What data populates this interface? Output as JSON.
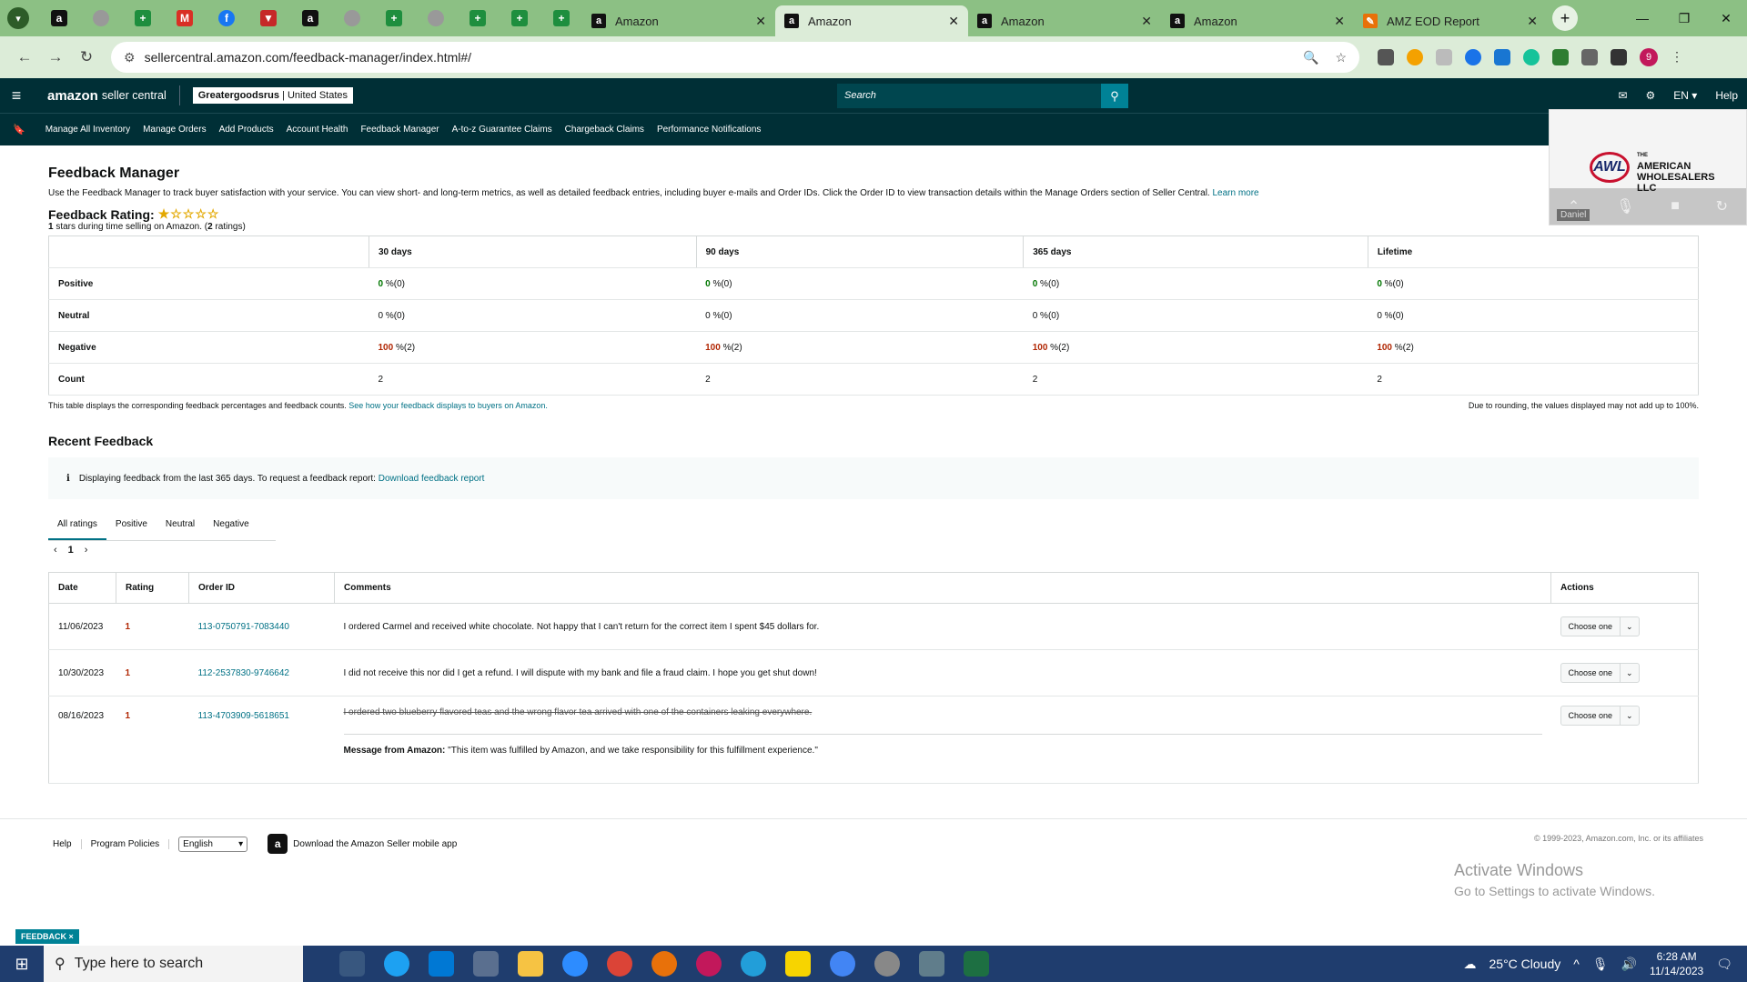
{
  "browser": {
    "tabs": [
      {
        "title": "Amazon"
      },
      {
        "title": "Amazon"
      },
      {
        "title": "Amazon"
      },
      {
        "title": "Amazon"
      },
      {
        "title": "AMZ EOD Report"
      }
    ],
    "url": "sellercentral.amazon.com/feedback-manager/index.html#/",
    "profile_initial": "9"
  },
  "header": {
    "logo": "amazon",
    "logo_suffix": "seller central",
    "store_name": "Greatergoodsrus",
    "store_region": "United States",
    "search_placeholder": "Search",
    "lang": "EN",
    "help": "Help"
  },
  "subnav": {
    "items": [
      "Manage All Inventory",
      "Manage Orders",
      "Add Products",
      "Account Health",
      "Feedback Manager",
      "A-to-z Guarantee Claims",
      "Chargeback Claims",
      "Performance Notifications"
    ]
  },
  "page": {
    "title": "Feedback Manager",
    "description": "Use the Feedback Manager to track buyer satisfaction with your service. You can view short- and long-term metrics, as well as detailed feedback entries, including buyer e-mails and Order IDs. Click the Order ID to view transaction details within the Manage Orders section of Seller Central.",
    "learn_more": "Learn more",
    "rating_label": "Feedback Rating:",
    "rating_stars": 1,
    "rating_sub_value": "1",
    "rating_sub_text": "stars during time selling on Amazon. (",
    "rating_count": "2",
    "rating_count_suffix": "ratings)"
  },
  "metrics": {
    "columns": [
      "30 days",
      "90 days",
      "365 days",
      "Lifetime"
    ],
    "rows": [
      {
        "label": "Positive",
        "cells": [
          [
            "0",
            " %(0)"
          ],
          [
            "0",
            " %(0)"
          ],
          [
            "0",
            " %(0)"
          ],
          [
            "0",
            " %(0)"
          ]
        ]
      },
      {
        "label": "Neutral",
        "cells": [
          [
            "",
            "0 %(0)"
          ],
          [
            "",
            "0 %(0)"
          ],
          [
            "",
            "0 %(0)"
          ],
          [
            "",
            "0 %(0)"
          ]
        ]
      },
      {
        "label": "Negative",
        "cells": [
          [
            "100",
            " %(2)"
          ],
          [
            "100",
            " %(2)"
          ],
          [
            "100",
            " %(2)"
          ],
          [
            "100",
            " %(2)"
          ]
        ]
      },
      {
        "label": "Count",
        "cells": [
          [
            "",
            "2"
          ],
          [
            "",
            "2"
          ],
          [
            "",
            "2"
          ],
          [
            "",
            "2"
          ]
        ]
      }
    ],
    "note_left": "This table displays the corresponding feedback percentages and feedback counts.",
    "note_link": "See how your feedback displays to buyers on Amazon.",
    "note_right": "Due to rounding, the values displayed may not add up to 100%."
  },
  "recent": {
    "title": "Recent Feedback",
    "info_text": "Displaying feedback from the last 365 days. To request a feedback report:",
    "info_link": "Download feedback report",
    "filter_tabs": [
      "All ratings",
      "Positive",
      "Neutral",
      "Negative"
    ],
    "page": "1",
    "columns": [
      "Date",
      "Rating",
      "Order ID",
      "Comments",
      "Actions"
    ],
    "rows": [
      {
        "date": "11/06/2023",
        "rating": "1",
        "order_id": "113-0750791-7083440",
        "comment": "I ordered Carmel and received white chocolate. Not happy that I can't return for the correct item I spent $45 dollars for.",
        "action": "Choose one"
      },
      {
        "date": "10/30/2023",
        "rating": "1",
        "order_id": "112-2537830-9746642",
        "comment": "I did not receive this nor did I get a refund. I will dispute with my bank and file a fraud claim. I hope you get shut down!",
        "action": "Choose one"
      },
      {
        "date": "08/16/2023",
        "rating": "1",
        "order_id": "113-4703909-5618651",
        "comment": "I ordered two blueberry flavored teas and the wrong flavor tea arrived with one of the containers leaking everywhere.",
        "action": "Choose one"
      }
    ],
    "amazon_msg_label": "Message from Amazon:",
    "amazon_msg": "\"This item was fulfilled by Amazon, and we take responsibility for this fulfillment experience.\""
  },
  "footer": {
    "help": "Help",
    "policies": "Program Policies",
    "language": "English",
    "app": "Download the Amazon Seller mobile app",
    "copyright": "© 1999-2023, Amazon.com, Inc. or its affiliates",
    "feedback_tag": "FEEDBACK ×"
  },
  "overlay": {
    "activate_title": "Activate Windows",
    "activate_sub": "Go to Settings to activate Windows.",
    "video_name": "Daniel",
    "logo_letters": "AWL",
    "logo_text_the": "THE",
    "logo_text_1": "AMERICAN",
    "logo_text_2": "WHOLESALERS",
    "logo_text_3": "LLC"
  },
  "taskbar": {
    "search_placeholder": "Type here to search",
    "weather": "25°C  Cloudy",
    "time": "6:28 AM",
    "date": "11/14/2023"
  }
}
